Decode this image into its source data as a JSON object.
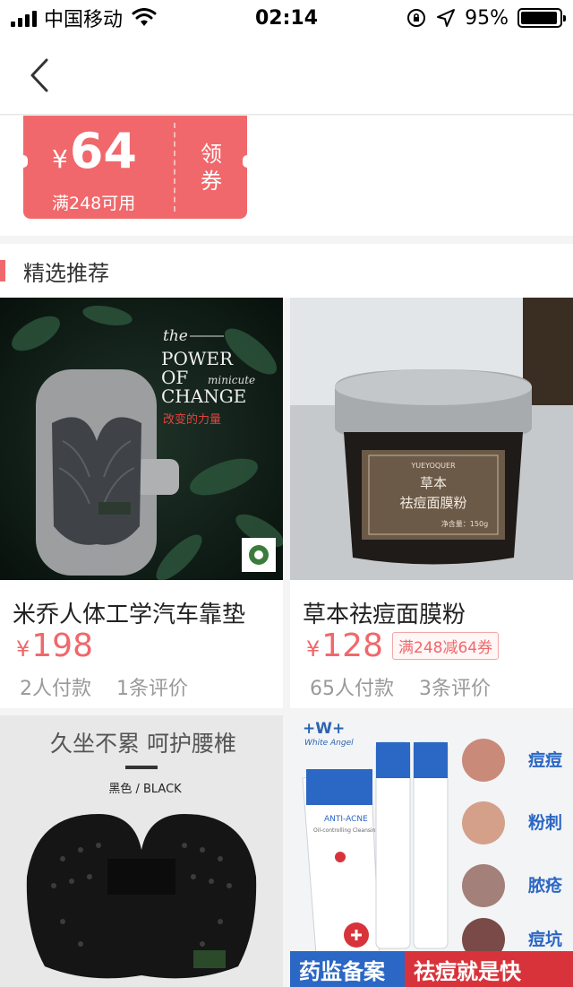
{
  "status_bar": {
    "carrier": "中国移动",
    "time": "02:14",
    "battery_percent": "95%",
    "battery_level": 0.95
  },
  "nav": {
    "back_icon": "chevron-left-icon"
  },
  "coupon": {
    "currency": "¥",
    "amount": "64",
    "condition": "满248可用",
    "action_line1": "领",
    "action_line2": "券",
    "color": "#f0686b"
  },
  "section": {
    "title": "精选推荐"
  },
  "products": [
    {
      "title": "米乔人体工学汽车靠垫",
      "currency": "¥",
      "price": "198",
      "promo": "",
      "paid": "2人付款",
      "reviews": "1条评价",
      "image": {
        "tagline_the": "the",
        "tagline_power": "POWER",
        "tagline_of": "OF",
        "tagline_minicute": "minicute",
        "tagline_change": "CHANGE",
        "tagline_cn": "改变的力量"
      }
    },
    {
      "title": "草本祛痘面膜粉",
      "currency": "¥",
      "price": "128",
      "promo": "满248减64券",
      "paid": "65人付款",
      "reviews": "3条评价",
      "image": {
        "jar_brand": "YUEYOQUER",
        "jar_line1": "草本",
        "jar_line2": "祛痘面膜粉",
        "jar_net": "净含量：150g"
      }
    },
    {
      "image": {
        "headline": "久坐不累 呵护腰椎",
        "color_label": "黑色 / BLACK"
      }
    },
    {
      "image": {
        "brand": "+W+",
        "brand_script": "White Angel",
        "tube_text": "ANTI-ACNE",
        "tube_sub": "Oil-controlling Cleansing cream",
        "labels": [
          "痘痘",
          "粉刺",
          "脓疮",
          "痘坑"
        ],
        "banner_left": "药监备案",
        "banner_right": "祛痘就是快"
      }
    }
  ]
}
